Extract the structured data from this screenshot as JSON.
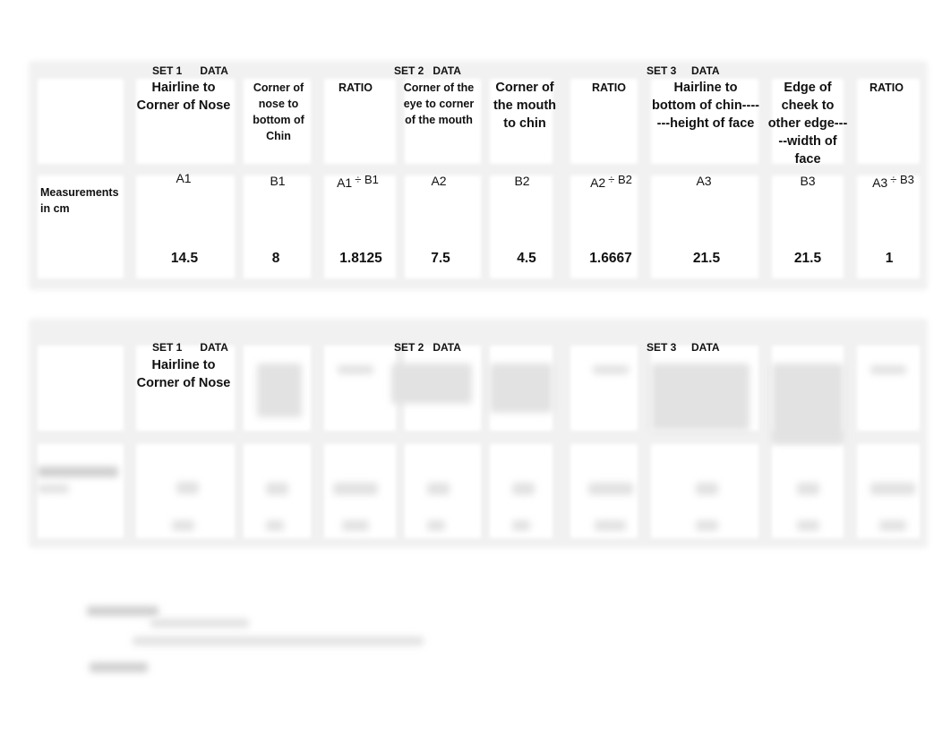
{
  "table1": {
    "row_label": "Measurements in cm",
    "sets": [
      {
        "set_label": "SET 1      DATA",
        "columns": [
          {
            "header": "Hairline to Corner of Nose",
            "formula": "A1",
            "value": "14.5"
          },
          {
            "header": "Corner of nose to bottom of Chin",
            "formula": "B1",
            "value": "8"
          },
          {
            "header": "RATIO",
            "formula_left": "A1",
            "formula_op": "÷",
            "formula_right": "B1",
            "value": "1.8125"
          }
        ]
      },
      {
        "set_label": "SET 2   DATA",
        "columns": [
          {
            "header": "Corner of the eye to corner of the mouth",
            "formula": "A2",
            "value": "7.5"
          },
          {
            "header": "Corner of the mouth to chin",
            "formula": "B2",
            "value": "4.5"
          },
          {
            "header": "RATIO",
            "formula_left": "A2",
            "formula_op": "÷",
            "formula_right": "B2",
            "value": "1.6667"
          }
        ]
      },
      {
        "set_label": "SET 3     DATA",
        "columns": [
          {
            "header": "Hairline to bottom of chin-------height of face",
            "formula": "A3",
            "value": "21.5"
          },
          {
            "header": "Edge of cheek to other edge-----width of face",
            "formula": "B3",
            "value": "21.5"
          },
          {
            "header": "RATIO",
            "formula_left": "A3",
            "formula_op": "÷",
            "formula_right": "B3",
            "value": "1"
          }
        ]
      }
    ]
  },
  "table2": {
    "sets": [
      {
        "set_label": "SET 1      DATA",
        "first_header": "Hairline to Corner of Nose"
      },
      {
        "set_label": "SET 2   DATA"
      },
      {
        "set_label": "SET 3     DATA"
      }
    ]
  }
}
